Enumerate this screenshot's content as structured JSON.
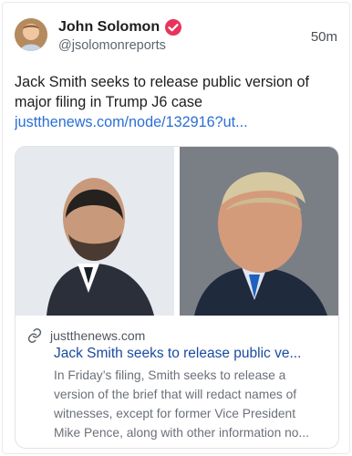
{
  "post": {
    "author_name": "John Solomon",
    "handle": "@jsolomonreports",
    "time": "50m",
    "text": "Jack Smith seeks to release public version of major filing in Trump J6 case",
    "link": "justthenews.com/node/132916?ut..."
  },
  "card": {
    "domain": "justthenews.com",
    "title": "Jack Smith seeks to release public ve...",
    "desc_lines": [
      "In Friday’s filing, Smith seeks to release a",
      "version of the brief that will redact names of",
      "witnesses, except for former Vice President",
      "Mike Pence, along with other information no..."
    ]
  },
  "colors": {
    "link": "#2a6fd6",
    "verified_badge": "#e8345c",
    "card_title": "#1a4aa1"
  },
  "icons": {
    "verified": "verified-badge-icon",
    "link": "link-icon"
  }
}
